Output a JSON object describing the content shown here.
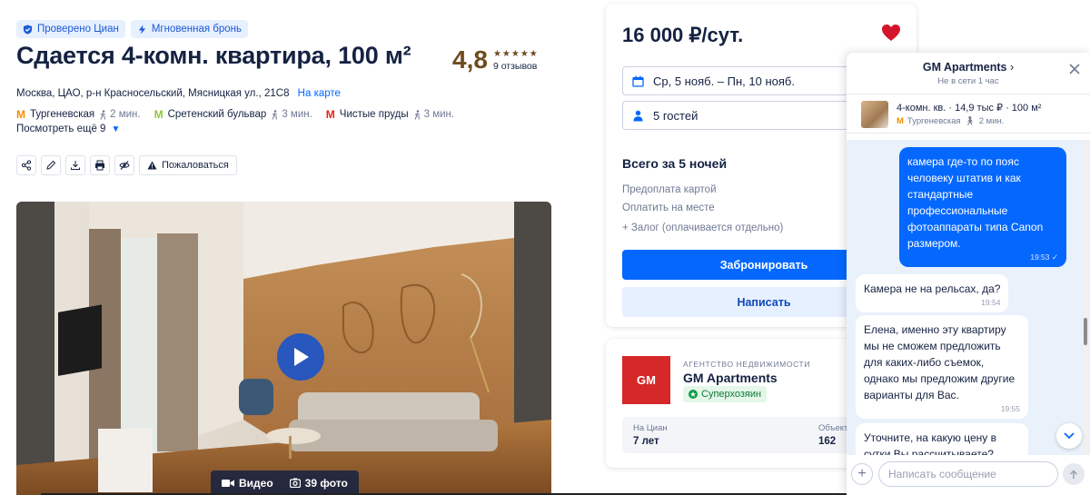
{
  "badges": {
    "verified": "Проверено Циан",
    "instant": "Мгновенная бронь"
  },
  "listing": {
    "title": "Сдается 4-комн. квартира, 100 м²",
    "rating": "4,8",
    "stars": "★★★★★",
    "reviews": "9 отзывов",
    "address": "Москва, ЦАО, р-н Красносельский, Мясницкая ул., 21С8",
    "map_link": "На карте",
    "metro": [
      {
        "name": "Тургеневская",
        "time": "2 мин.",
        "color": "#f28c00",
        "letter": "M"
      },
      {
        "name": "Сретенский бульвар",
        "time": "3 мин.",
        "color": "#8cc63e",
        "letter": "M"
      },
      {
        "name": "Чистые пруды",
        "time": "3 мин.",
        "color": "#e42313",
        "letter": "M"
      }
    ],
    "more": "Посмотреть ещё 9",
    "report": "Пожаловаться",
    "video": "Видео",
    "photos": "39 фото"
  },
  "booking": {
    "price": "16 000 ₽/сут.",
    "dates": "Ср, 5 нояб. – Пн, 10 нояб.",
    "guests": "5 гостей",
    "total": "Всего за 5 ночей",
    "prepay": "Предоплата картой",
    "onsite": "Оплатить на месте",
    "deposit": "+ Залог (оплачивается отдельно)",
    "book_btn": "Забронировать",
    "write_btn": "Написать"
  },
  "agency": {
    "type": "АГЕНТСТВО НЕДВИЖИМОСТИ",
    "name": "GM Apartments",
    "badge": "Суперхозяин",
    "logo_text": "GM",
    "stat1_label": "На Циан",
    "stat1_value": "7 лет",
    "stat2_label": "Объект",
    "stat2_value": "162"
  },
  "chat": {
    "name": "GM Apartments",
    "status": "Не в сети 1 час",
    "offer_title": "4-комн. кв. · 14,9 тыс ₽ · 100 м²",
    "offer_metro": "Тургеневская",
    "offer_time": "2 мин.",
    "placeholder": "Написать сообщение",
    "messages": [
      {
        "dir": "out",
        "text": "камера где-то по пояс человеку штатив и как стандартные профессиональные фотоаппараты типа Canon размером.",
        "time": "19:53 ✓"
      },
      {
        "dir": "in",
        "text": "Камера не на рельсах, да?",
        "time": "19:54"
      },
      {
        "dir": "in",
        "text": "Елена, именно эту квартиру мы не сможем предложить для каких-либо съемок, однако мы предложим другие варианты для Вас.",
        "time": "19:55"
      },
      {
        "dir": "in",
        "text": "Уточните, на какую цену в сутки Вы рассчитываете?",
        "time": ""
      }
    ]
  },
  "colors": {
    "accent": "#0468ff",
    "heart": "#d4152a",
    "rating": "#6f4b20"
  }
}
